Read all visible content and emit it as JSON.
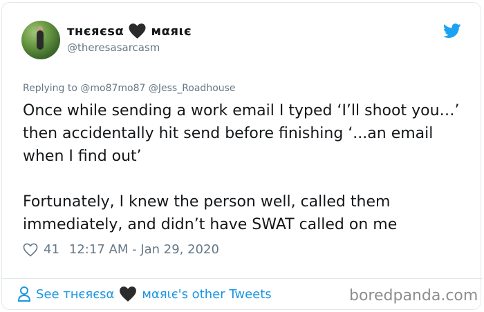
{
  "tweet": {
    "display_name_part1": "ᴛнєяєѕα",
    "display_name_part2": "мαяιє",
    "handle": "@theresasarcasm",
    "replying_to": "Replying to @mo87mo87 @Jess_Roadhouse",
    "text": "Once while sending a work email I typed ‘I’ll shoot you…’ then accidentally hit send before finishing ‘...an email when I find out’\n\nFortunately, I knew the person well, called them immediately, and didn’t have SWAT called on me",
    "likes": "41",
    "timestamp": "12:17 AM - Jan 29, 2020"
  },
  "footer": {
    "link_prefix": "See ᴛнєяєѕα",
    "link_suffix": "мαяιє's other Tweets"
  },
  "watermark": "boredpanda.com",
  "colors": {
    "accent": "#1b95e0",
    "twitter_bird": "#1da1f2",
    "muted": "#657786",
    "border": "#e1e8ed"
  },
  "icons": [
    "twitter-bird-icon",
    "black-heart-icon",
    "heart-outline-icon",
    "person-icon"
  ]
}
